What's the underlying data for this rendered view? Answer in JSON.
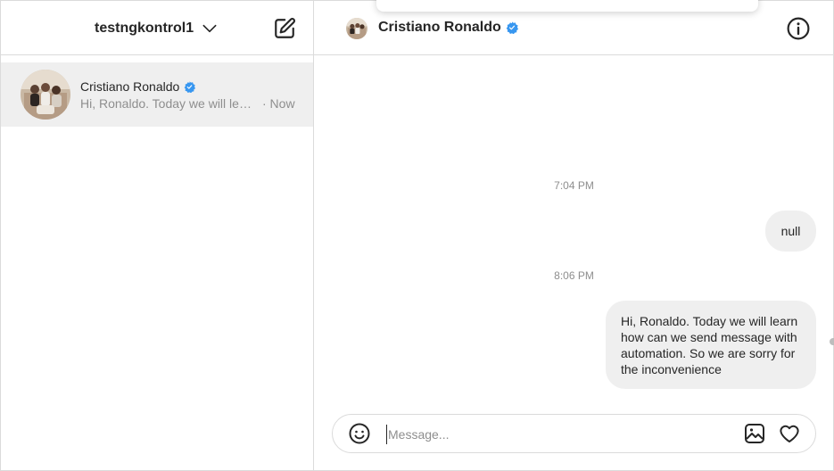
{
  "sidebar": {
    "account_name": "testngkontrol1",
    "icons": {
      "chevron": "chevron-down-icon",
      "compose": "new-message-icon"
    },
    "threads": [
      {
        "name": "Cristiano Ronaldo",
        "verified": true,
        "preview": "Hi, Ronaldo. Today we will learn how can we send message with automation. So we are sorry for the inconvenience",
        "time": "· Now",
        "selected": true
      }
    ]
  },
  "chat": {
    "contact_name": "Cristiano Ronaldo",
    "verified": true,
    "icons": {
      "info": "info-icon",
      "emoji": "emoji-icon",
      "image": "image-icon",
      "like": "heart-icon"
    },
    "messages": [
      {
        "timestamp": "7:04 PM",
        "text": "null",
        "from_me": true
      },
      {
        "timestamp": "8:06 PM",
        "text": "Hi, Ronaldo. Today we will learn\nhow can we send message with\nautomation. So we are sorry for\nthe inconvenience",
        "from_me": true
      }
    ],
    "composer": {
      "placeholder": "Message...",
      "value": ""
    }
  },
  "colors": {
    "border": "#dbdbdb",
    "selected_thread_bg": "#efefef",
    "bubble_bg": "#efefef",
    "verified_blue": "#3897f0",
    "muted_text": "#8e8e8e",
    "text": "#262626"
  }
}
